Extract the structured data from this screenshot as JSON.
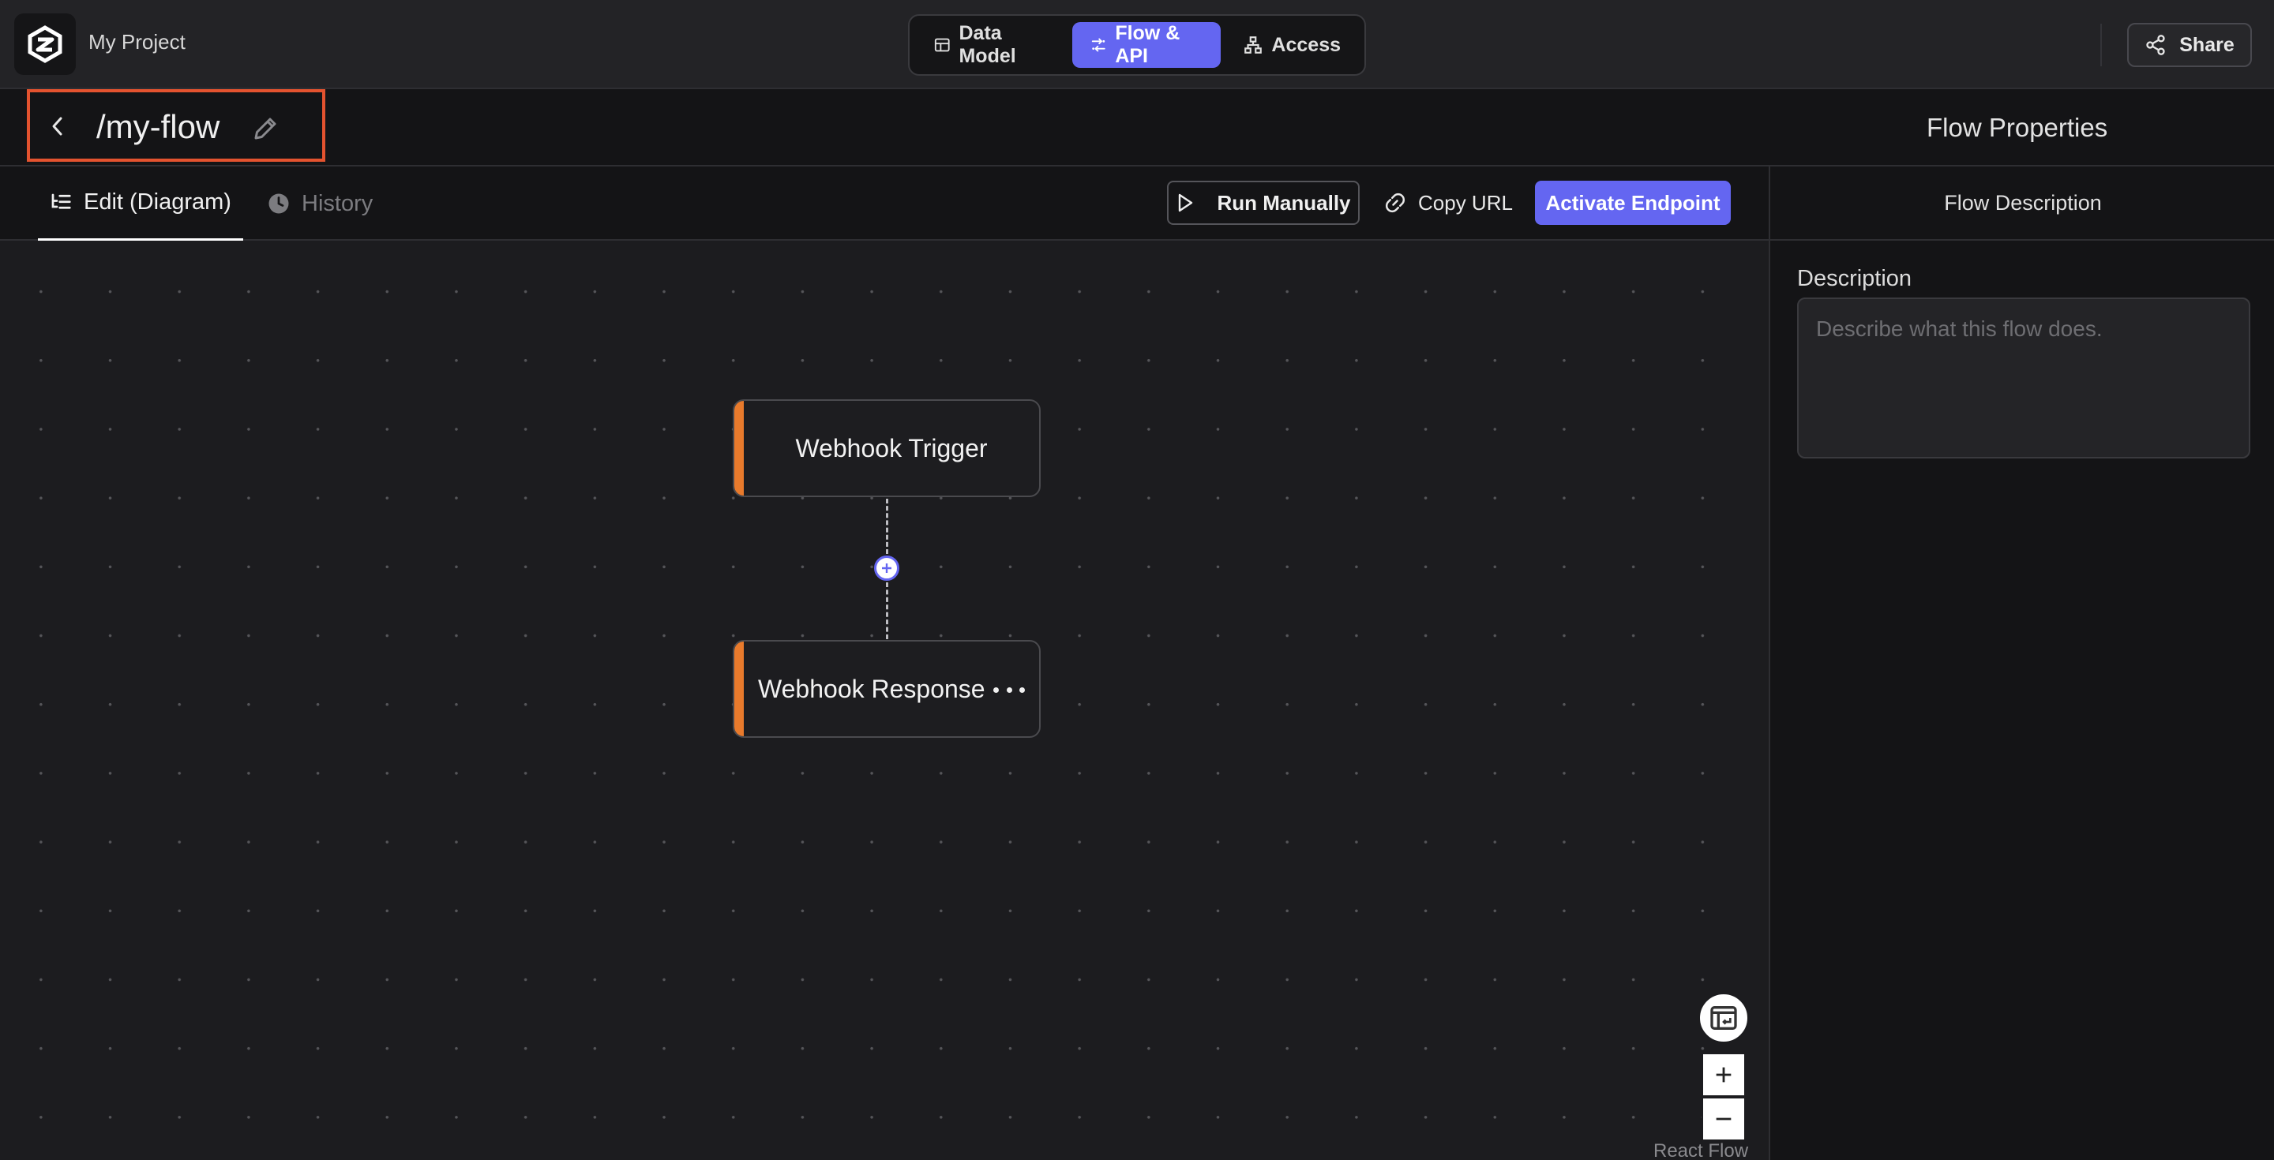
{
  "topbar": {
    "project_name": "My Project",
    "modes": [
      {
        "label": "Data Model",
        "icon": "table-icon"
      },
      {
        "label": "Flow & API",
        "icon": "flow-icon",
        "active": true
      },
      {
        "label": "Access",
        "icon": "sitemap-icon"
      }
    ],
    "share_label": "Share",
    "accent_color": "#6466f1"
  },
  "title_row": {
    "flow_title": "/my-flow",
    "properties_title": "Flow Properties"
  },
  "tabs": {
    "edit_label": "Edit (Diagram)",
    "history_label": "History"
  },
  "actions": {
    "run_label": "Run Manually",
    "copy_label": "Copy URL",
    "activate_label": "Activate Endpoint"
  },
  "right_panel": {
    "tab_label": "Flow Description",
    "description_label": "Description",
    "description_placeholder": "Describe what this flow does.",
    "description_value": ""
  },
  "canvas": {
    "nodes": [
      {
        "label": "Webhook Trigger",
        "accent": "#e87a2c"
      },
      {
        "label": "Webhook Response",
        "accent": "#e87a2c"
      }
    ],
    "attribution": "React Flow"
  }
}
